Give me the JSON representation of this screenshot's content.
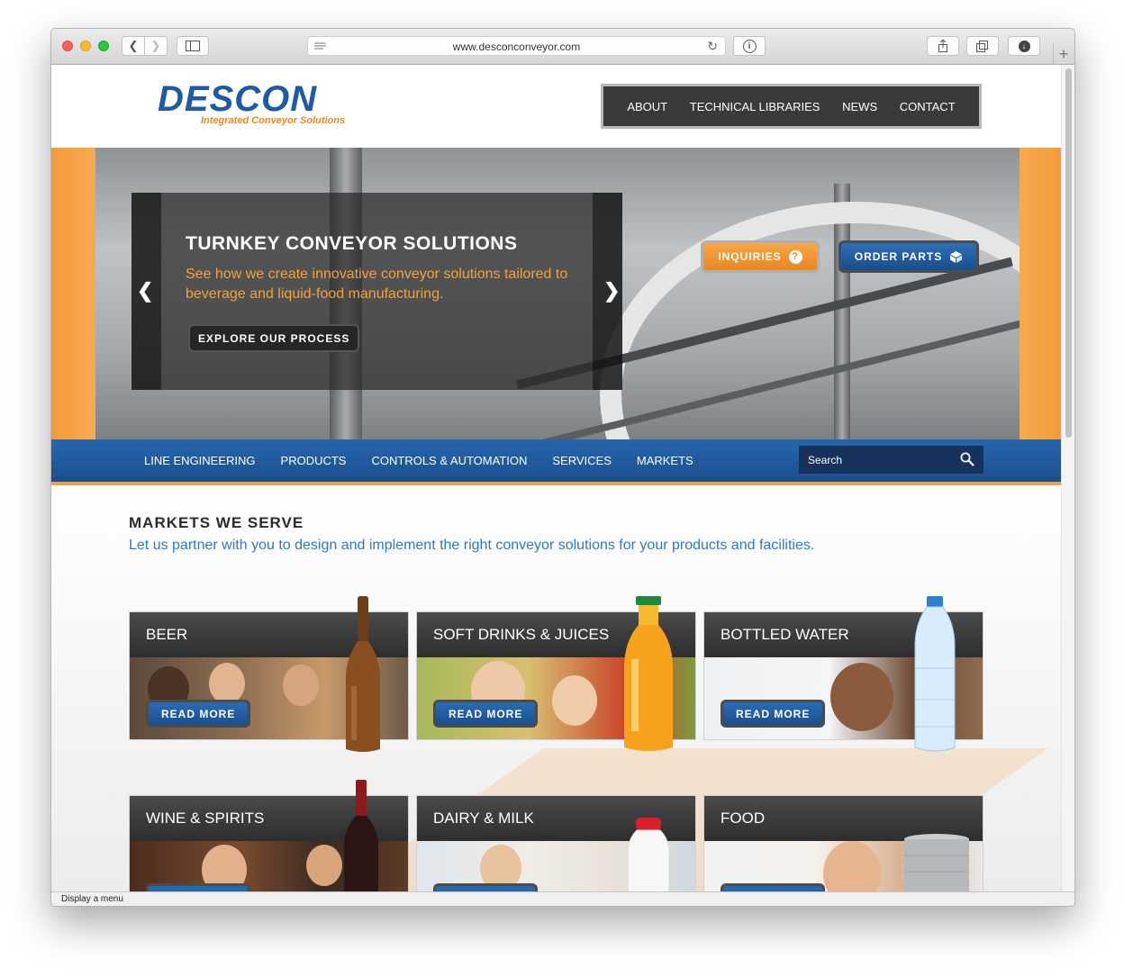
{
  "browser": {
    "url": "www.desconconveyor.com",
    "status_text": "Display a menu"
  },
  "header": {
    "logo_text": "DESCON",
    "logo_tagline": "Integrated Conveyor Solutions",
    "top_nav": [
      "ABOUT",
      "TECHNICAL LIBRARIES",
      "NEWS",
      "CONTACT"
    ]
  },
  "hero": {
    "title": "TURNKEY CONVEYOR SOLUTIONS",
    "text": "See how we create innovative conveyor solutions tailored to beverage and liquid-food manufacturing.",
    "cta_label": "EXPLORE OUR PROCESS",
    "inquiries_label": "INQUIRIES",
    "order_parts_label": "ORDER PARTS"
  },
  "main_nav": {
    "items": [
      "LINE ENGINEERING",
      "PRODUCTS",
      "CONTROLS & AUTOMATION",
      "SERVICES",
      "MARKETS"
    ],
    "search_placeholder": "Search"
  },
  "markets": {
    "title": "MARKETS WE SERVE",
    "subtitle": "Let us partner with you to design and implement the right conveyor solutions for your products and facilities.",
    "read_more_label": "READ MORE",
    "cards": [
      {
        "label": "BEER"
      },
      {
        "label": "SOFT DRINKS & JUICES"
      },
      {
        "label": "BOTTLED WATER"
      },
      {
        "label": "WINE & SPIRITS"
      },
      {
        "label": "DAIRY & MILK"
      },
      {
        "label": "FOOD"
      }
    ]
  },
  "colors": {
    "brand_blue": "#1f5aa6",
    "brand_orange": "#f0891c",
    "accent_text_blue": "#2e7bc0"
  }
}
